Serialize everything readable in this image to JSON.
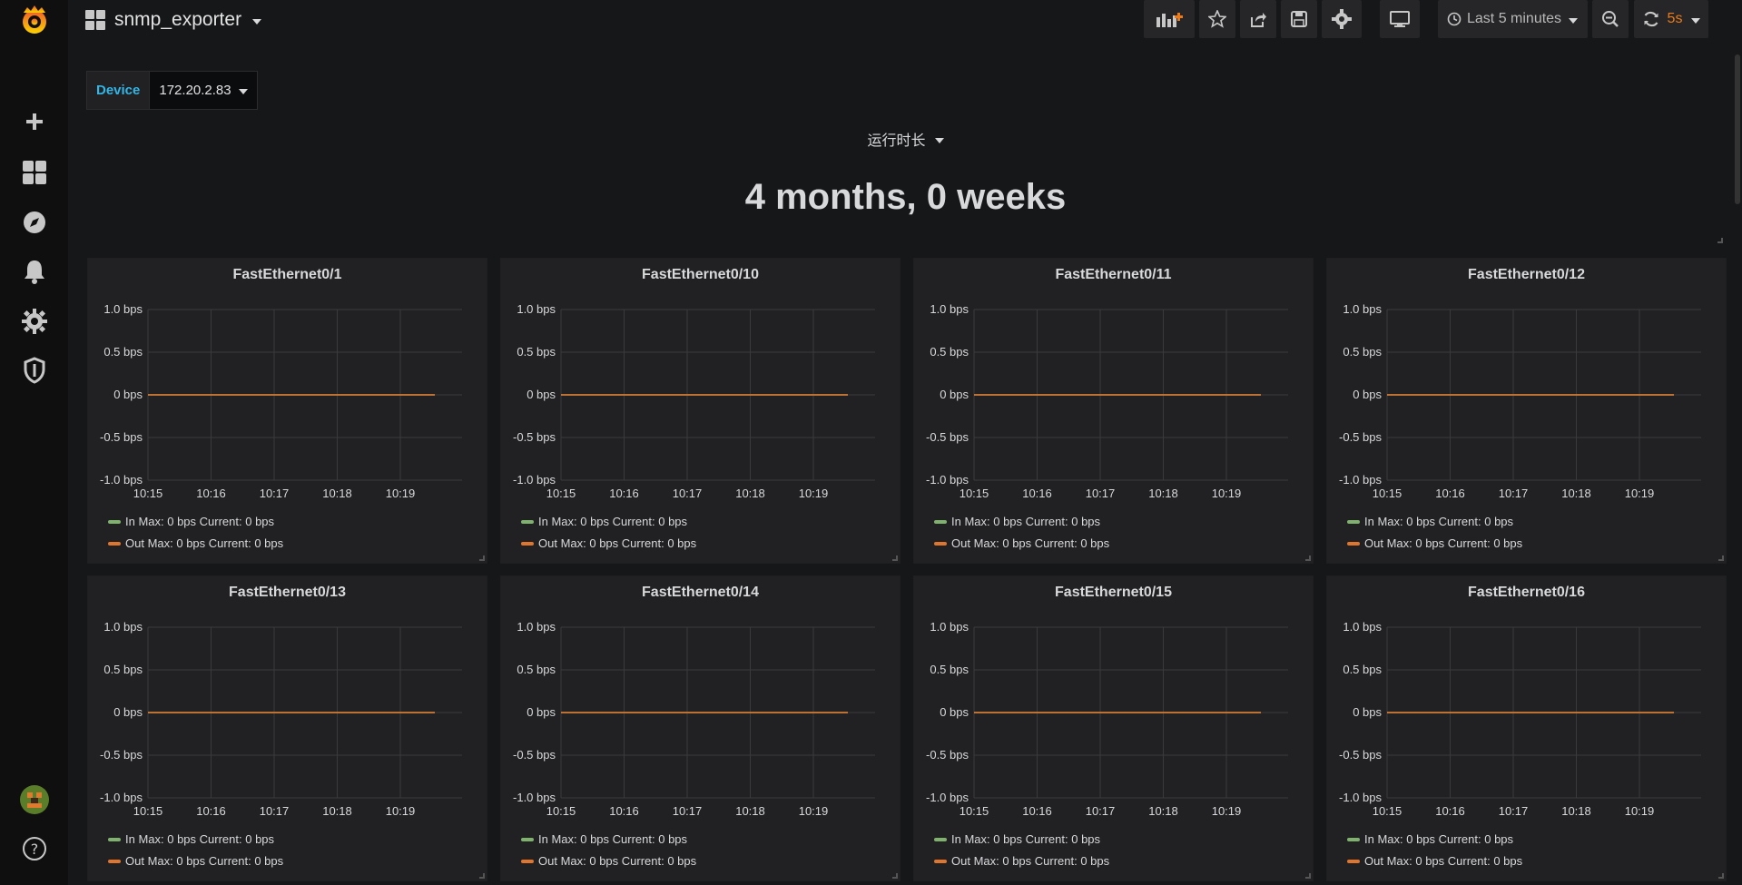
{
  "dashboard": {
    "title": "snmp_exporter"
  },
  "navbar": {
    "time_range": "Last 5 minutes",
    "refresh": "5s"
  },
  "variable": {
    "label": "Device",
    "value": "172.20.2.83"
  },
  "stat": {
    "title": "运行时长",
    "value": "4 months, 0 weeks"
  },
  "panels": [
    {
      "title": "FastEthernet0/1"
    },
    {
      "title": "FastEthernet0/10"
    },
    {
      "title": "FastEthernet0/11"
    },
    {
      "title": "FastEthernet0/12"
    },
    {
      "title": "FastEthernet0/13"
    },
    {
      "title": "FastEthernet0/14"
    },
    {
      "title": "FastEthernet0/15"
    },
    {
      "title": "FastEthernet0/16"
    }
  ],
  "legend": {
    "in": "In  Max: 0 bps  Current: 0 bps",
    "out": "Out  Max: 0 bps  Current: 0 bps"
  },
  "colors": {
    "in": "#7eb26d",
    "out": "#e0752d",
    "accent": "#eb7b18"
  },
  "chart_data": {
    "type": "line",
    "x": [
      "10:15",
      "10:16",
      "10:17",
      "10:18",
      "10:19"
    ],
    "y_ticks": [
      "1.0 bps",
      "0.5 bps",
      "0 bps",
      "-0.5 bps",
      "-1.0 bps"
    ],
    "ylim": [
      -1,
      1
    ],
    "series": [
      {
        "name": "In",
        "values": [
          0,
          0,
          0,
          0,
          0
        ]
      },
      {
        "name": "Out",
        "values": [
          0,
          0,
          0,
          0,
          0
        ]
      }
    ]
  }
}
